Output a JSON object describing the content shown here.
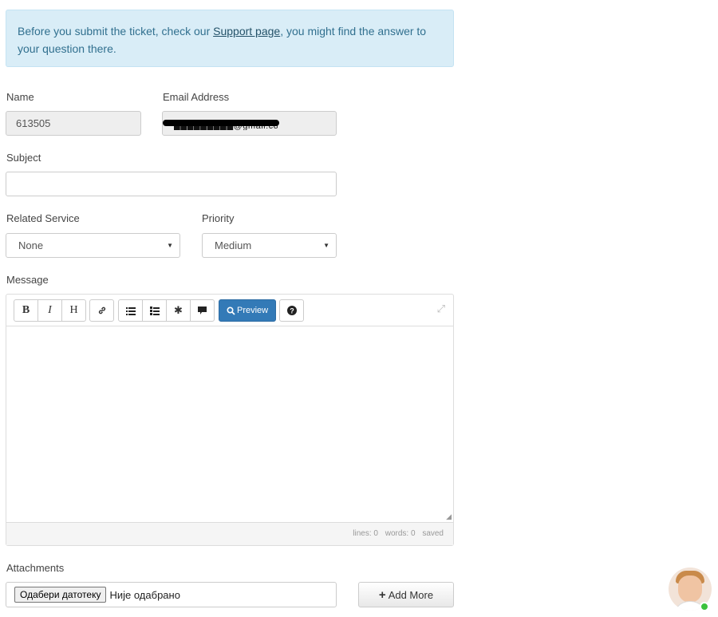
{
  "notice": {
    "text_before": "Before you submit the ticket, check our ",
    "link_text": "Support page",
    "text_after": ", you might find the answer to your question there."
  },
  "form": {
    "name_label": "Name",
    "name_value": "613505",
    "email_label": "Email Address",
    "email_value": "█████████@gmail.com",
    "subject_label": "Subject",
    "subject_value": "",
    "related_service_label": "Related Service",
    "related_service_value": "None",
    "priority_label": "Priority",
    "priority_value": "Medium",
    "message_label": "Message",
    "attachments_label": "Attachments"
  },
  "editor": {
    "toolbar": {
      "bold": "B",
      "italic": "I",
      "heading": "H",
      "link_icon": "link-icon",
      "unordered_list_icon": "list-ul-icon",
      "ordered_list_icon": "list-ol-icon",
      "quote_icon": "asterisk-icon",
      "comment_icon": "comment-icon",
      "preview_label": "Preview",
      "help_icon": "question-icon",
      "fullscreen_icon": "fullscreen-icon"
    },
    "status": {
      "lines": "lines: 0",
      "words": "words: 0",
      "saved": "saved"
    }
  },
  "attachments": {
    "choose_file_label": "Одабери датотеку",
    "no_file_text": "Није одабрано",
    "add_more_label": "Add More"
  },
  "colors": {
    "alert_bg": "#d9edf7",
    "primary": "#337ab7",
    "online": "#3cc23c"
  }
}
